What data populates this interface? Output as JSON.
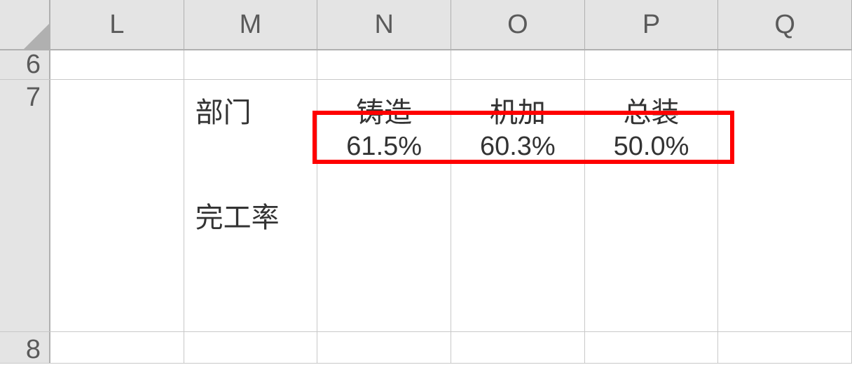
{
  "columns": [
    "L",
    "M",
    "N",
    "O",
    "P",
    "Q"
  ],
  "rows": [
    "6",
    "7",
    "8"
  ],
  "content": {
    "dept_label": "部门",
    "completion_label": "完工率",
    "headers": {
      "n": "铸造",
      "o": "机加",
      "p": "总装"
    },
    "values": {
      "n": "61.5%",
      "o": "60.3%",
      "p": "50.0%"
    }
  },
  "highlight": {
    "color": "#ff0000"
  }
}
